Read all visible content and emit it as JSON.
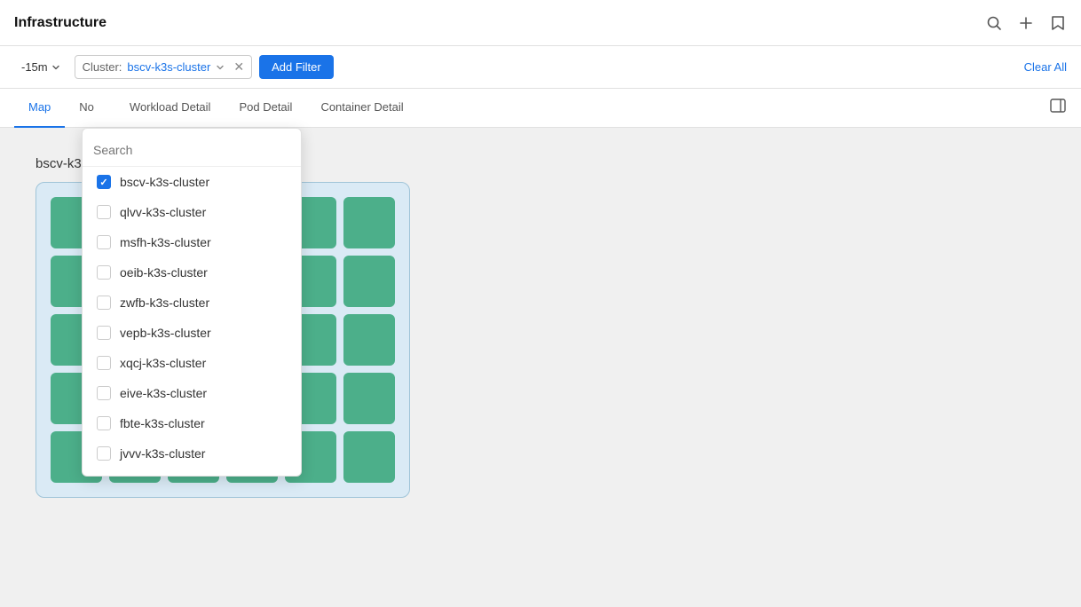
{
  "header": {
    "title": "Infrastructure",
    "icons": [
      "search-icon",
      "plus-icon",
      "bookmark-icon"
    ]
  },
  "filter_bar": {
    "time_label": "-15m",
    "cluster_label": "Cluster:",
    "cluster_value": "bscv-k3s-cluster",
    "add_filter_label": "Add Filter",
    "clear_all_label": "Clear All"
  },
  "tabs": {
    "items": [
      {
        "id": "map",
        "label": "Map",
        "active": true
      },
      {
        "id": "node",
        "label": "No",
        "active": false
      },
      {
        "id": "workload-detail",
        "label": "Workload Detail",
        "active": false
      },
      {
        "id": "pod-detail",
        "label": "Pod Detail",
        "active": false
      },
      {
        "id": "container-detail",
        "label": "Container Detail",
        "active": false
      }
    ]
  },
  "dropdown": {
    "search_placeholder": "Search",
    "items": [
      {
        "label": "bscv-k3s-cluster",
        "checked": true
      },
      {
        "label": "qlvv-k3s-cluster",
        "checked": false
      },
      {
        "label": "msfh-k3s-cluster",
        "checked": false
      },
      {
        "label": "oeib-k3s-cluster",
        "checked": false
      },
      {
        "label": "zwfb-k3s-cluster",
        "checked": false
      },
      {
        "label": "vepb-k3s-cluster",
        "checked": false
      },
      {
        "label": "xqcj-k3s-cluster",
        "checked": false
      },
      {
        "label": "eive-k3s-cluster",
        "checked": false
      },
      {
        "label": "fbte-k3s-cluster",
        "checked": false
      },
      {
        "label": "jvvv-k3s-cluster",
        "checked": false
      }
    ]
  },
  "cluster": {
    "name": "bscv-k3s-cluster",
    "node_rows": 5,
    "node_cols": 6
  }
}
